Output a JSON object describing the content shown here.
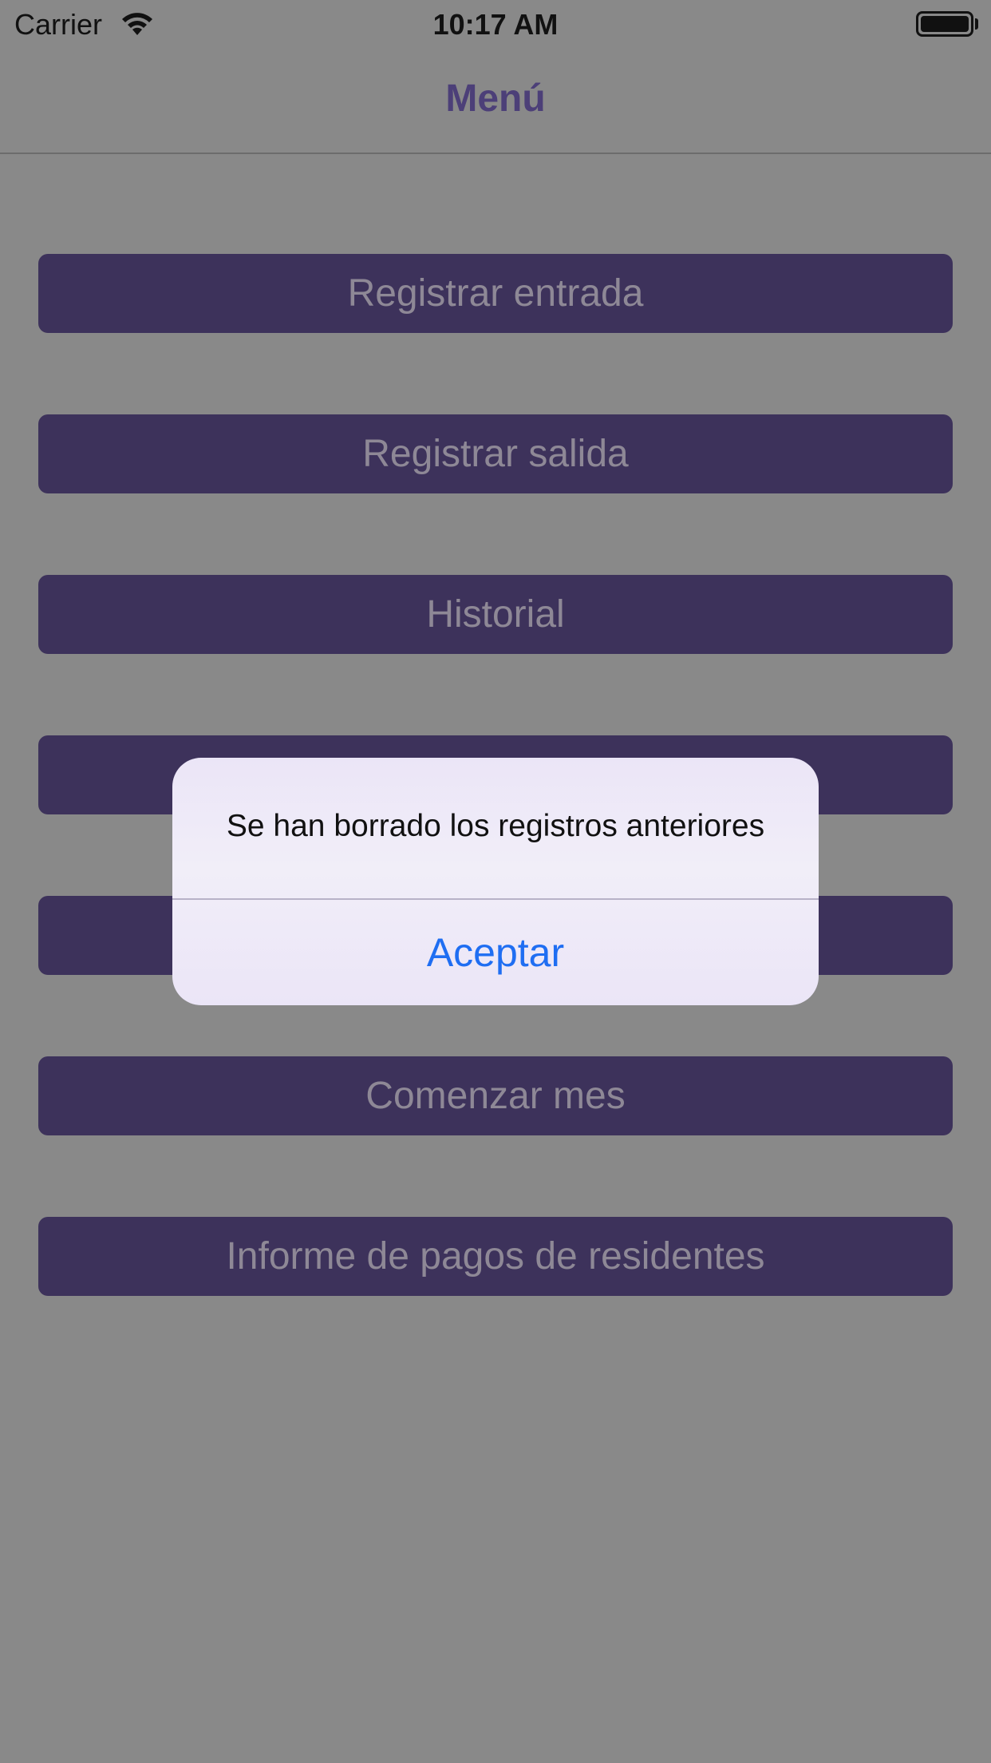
{
  "status_bar": {
    "carrier": "Carrier",
    "time": "10:17 AM",
    "wifi_icon": "wifi-icon",
    "battery_icon": "battery-icon"
  },
  "nav": {
    "title": "Menú",
    "title_color": "#4c3f78"
  },
  "menu": {
    "button_color": "#3d325b",
    "items": [
      {
        "label": "Registrar entrada"
      },
      {
        "label": "Registrar salida"
      },
      {
        "label": "Historial"
      },
      {
        "label": ""
      },
      {
        "label": ""
      },
      {
        "label": "Comenzar mes"
      },
      {
        "label": "Informe de pagos de residentes"
      }
    ]
  },
  "alert": {
    "message": "Se han borrado los registros anteriores",
    "button_label": "Aceptar",
    "button_color": "#1f6ef2"
  }
}
